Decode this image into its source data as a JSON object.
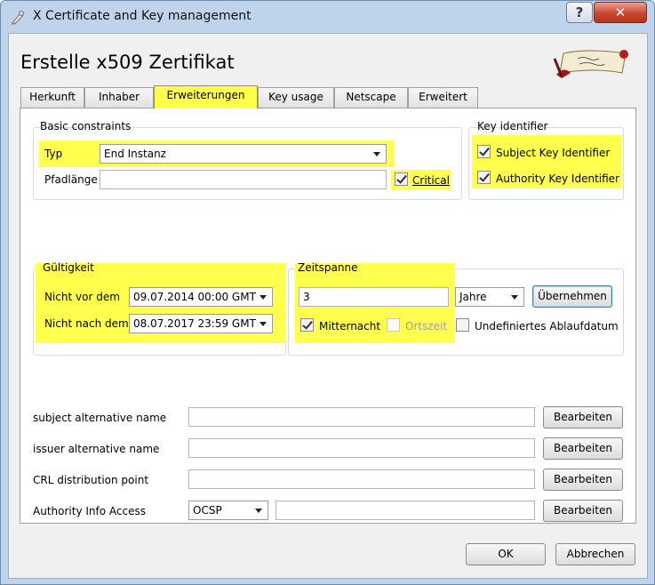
{
  "window": {
    "title": "X Certificate and Key management",
    "help_label": "?",
    "close_label": "✕"
  },
  "heading": "Erstelle x509 Zertifikat",
  "tabs": [
    {
      "label": "Herkunft"
    },
    {
      "label": "Inhaber"
    },
    {
      "label": "Erweiterungen",
      "active": true
    },
    {
      "label": "Key usage"
    },
    {
      "label": "Netscape"
    },
    {
      "label": "Erweitert"
    }
  ],
  "basic_constraints": {
    "title": "Basic constraints",
    "typ_label": "Typ",
    "typ_value": "End Instanz",
    "pfadlaenge_label": "Pfadlänge",
    "pfadlaenge_value": "",
    "critical_label": "Critical",
    "critical_checked": true
  },
  "key_identifier": {
    "title": "Key identifier",
    "subject_label": "Subject Key Identifier",
    "subject_checked": true,
    "authority_label": "Authority Key Identifier",
    "authority_checked": true
  },
  "gueltigkeit": {
    "title": "Gültigkeit",
    "nicht_vor_label": "Nicht vor dem",
    "nicht_vor_value": "09.07.2014 00:00 GMT",
    "nicht_nach_label": "Nicht nach dem",
    "nicht_nach_value": "08.07.2017 23:59 GMT"
  },
  "zeitspanne": {
    "title": "Zeitspanne",
    "value": "3",
    "unit": "Jahre",
    "apply_label": "Übernehmen",
    "mitternacht_label": "Mitternacht",
    "mitternacht_checked": true,
    "ortszeit_label": "Ortszeit",
    "ortszeit_checked": false,
    "undef_label": "Undefiniertes Ablaufdatum",
    "undef_checked": false
  },
  "extensions": [
    {
      "label": "subject alternative name",
      "value": "",
      "button": "Bearbeiten"
    },
    {
      "label": "issuer alternative name",
      "value": "",
      "button": "Bearbeiten"
    },
    {
      "label": "CRL distribution point",
      "value": "",
      "button": "Bearbeiten"
    },
    {
      "label": "Authority Info Access",
      "select": "OCSP",
      "value": "",
      "button": "Bearbeiten"
    }
  ],
  "footer": {
    "ok_label": "OK",
    "cancel_label": "Abbrechen"
  },
  "colors": {
    "highlight": "#ffff4d",
    "titlebar": "#bfd4ea",
    "close_button": "#c8472c"
  },
  "icons": {
    "app": "certificate-ribbon-icon",
    "logo": "scroll-logo"
  }
}
